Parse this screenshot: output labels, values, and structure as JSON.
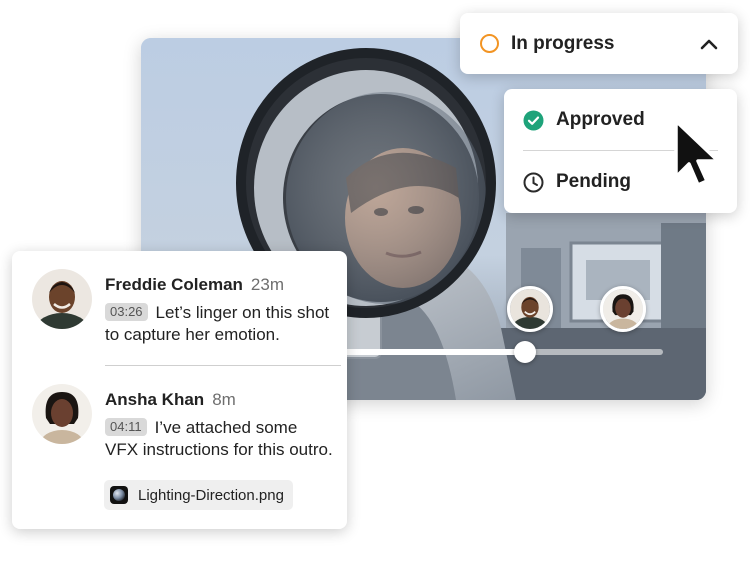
{
  "status": {
    "current": "In progress",
    "current_color": "#f29423",
    "options": [
      {
        "label": "Approved",
        "icon": "check-circle-icon",
        "color": "#1ea37a"
      },
      {
        "label": "Pending",
        "icon": "clock-icon",
        "color": "#2b2b2b"
      }
    ]
  },
  "video": {
    "progress": 0.57
  },
  "comments": [
    {
      "author": "Freddie Coleman",
      "time": "23m",
      "timestamp": "03:26",
      "text": "Let’s linger on this shot to capture her emotion."
    },
    {
      "author": "Ansha Khan",
      "time": "8m",
      "timestamp": "04:11",
      "text": "I’ve attached some VFX instructions for this outro.",
      "attachment": "Lighting-Direction.png"
    }
  ]
}
